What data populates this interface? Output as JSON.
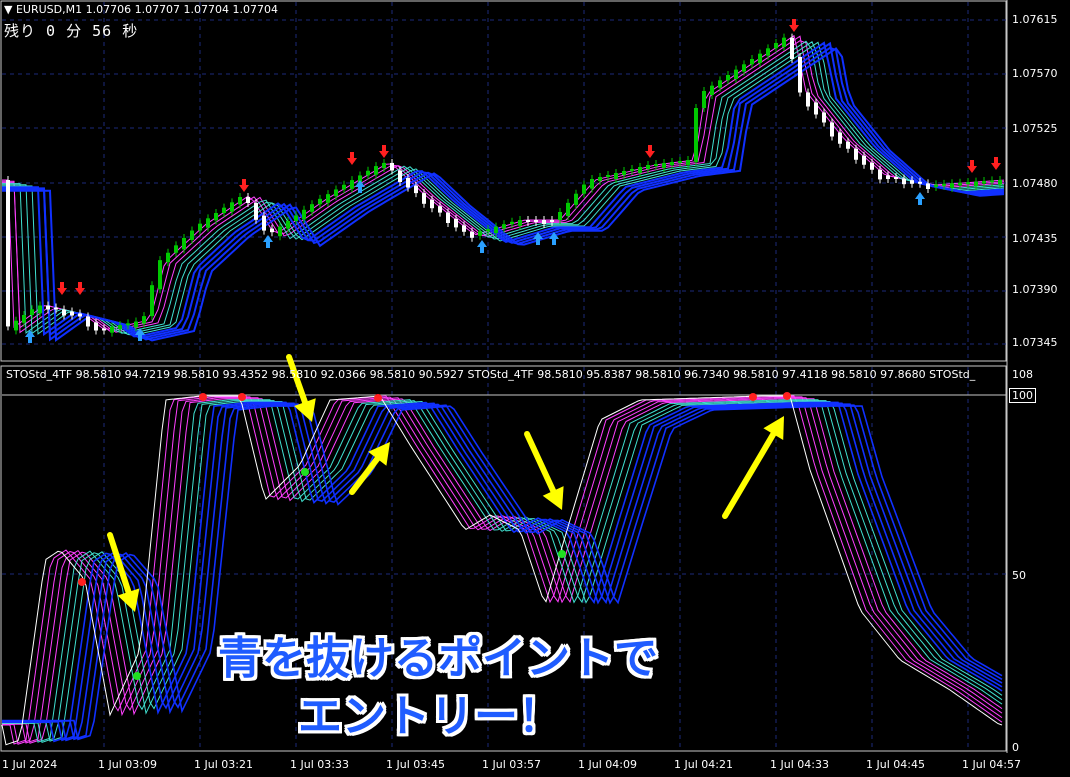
{
  "header": {
    "symbol_line": "▼ EURUSD,M1  1.07706 1.07707 1.07704 1.07704",
    "timer": "残り 0 分 56 秒"
  },
  "subwindow": {
    "info": "STOStd_4TF 98.5810 94.7219 98.5810 93.4352 98.5810 92.0366 98.5810 90.5927   STOStd_4TF 98.5810 95.8387 98.5810 96.7340 98.5810 97.4118 98.5810 97.8680   STOStd_",
    "level_top_label": "108",
    "level_box": "100",
    "level_mid": "50",
    "level_bottom": "0"
  },
  "price_axis": [
    "1.07615",
    "1.07570",
    "1.07525",
    "1.07480",
    "1.07435",
    "1.07390",
    "1.07345"
  ],
  "time_axis": [
    "1 Jul 2024",
    "1 Jul 03:09",
    "1 Jul 03:21",
    "1 Jul 03:33",
    "1 Jul 03:45",
    "1 Jul 03:57",
    "1 Jul 04:09",
    "1 Jul 04:21",
    "1 Jul 04:33",
    "1 Jul 04:45",
    "1 Jul 04:57"
  ],
  "caption": {
    "line1": "青を抜けるポイントで",
    "line2": "エントリー！"
  },
  "colors": {
    "background": "#000000",
    "grid": "#1b2a7a",
    "bull_candle": "#00c800",
    "bear_candle": "#ffffff",
    "ma_fast": "#ff40ff",
    "ma_mid": "#40e0d0",
    "ma_slow": "#1030ff",
    "arrow_annotation": "#ffff00",
    "caption_text": "#1f5cff"
  }
}
